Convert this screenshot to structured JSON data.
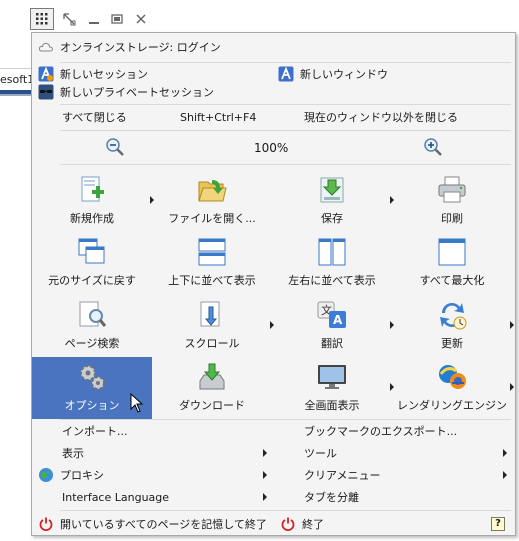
{
  "background": {
    "url_fragment": "esoft1"
  },
  "titlebar": {
    "menu_icon": "grid-menu-icon",
    "buttons": [
      "restore-down-icon",
      "minimize-icon",
      "maximize-icon",
      "close-icon"
    ]
  },
  "menu": {
    "online_storage": "オンラインストレージ: ログイン",
    "new_session": "新しいセッション",
    "new_window": "新しいウィンドウ",
    "new_private_session": "新しいプライベートセッション",
    "close_all": "すべて閉じる",
    "close_all_shortcut": "Shift+Ctrl+F4",
    "close_others": "現在のウィンドウ以外を閉じる",
    "zoom_level": "100%",
    "grid": [
      {
        "label": "新規作成",
        "icon": "new-document-icon",
        "submenu": true
      },
      {
        "label": "ファイルを開く...",
        "icon": "open-folder-icon",
        "submenu": false
      },
      {
        "label": "保存",
        "icon": "save-icon",
        "submenu": true
      },
      {
        "label": "印刷",
        "icon": "printer-icon",
        "submenu": false
      },
      {
        "label": "元のサイズに戻す",
        "icon": "cascade-windows-icon",
        "submenu": false
      },
      {
        "label": "上下に並べて表示",
        "icon": "tile-horizontal-icon",
        "submenu": false
      },
      {
        "label": "左右に並べて表示",
        "icon": "tile-vertical-icon",
        "submenu": false
      },
      {
        "label": "すべて最大化",
        "icon": "maximize-all-icon",
        "submenu": false
      },
      {
        "label": "ページ検索",
        "icon": "page-search-icon",
        "submenu": false
      },
      {
        "label": "スクロール",
        "icon": "scroll-icon",
        "submenu": true
      },
      {
        "label": "翻訳",
        "icon": "translate-icon",
        "submenu": true
      },
      {
        "label": "更新",
        "icon": "refresh-icon",
        "submenu": true
      },
      {
        "label": "オプション",
        "icon": "options-gears-icon",
        "submenu": false,
        "selected": true
      },
      {
        "label": "ダウンロード",
        "icon": "download-icon",
        "submenu": false
      },
      {
        "label": "全画面表示",
        "icon": "fullscreen-monitor-icon",
        "submenu": true
      },
      {
        "label": "レンダリングエンジン",
        "icon": "rendering-engine-icon",
        "submenu": true
      }
    ],
    "import": "インポート...",
    "export_bookmarks": "ブックマークのエクスポート...",
    "view": "表示",
    "tools": "ツール",
    "proxy": "プロキシ",
    "clear_menu": "クリアメニュー",
    "interface_language": "Interface Language",
    "split_tab": "タブを分離",
    "remember_and_exit": "開いているすべてのページを記憶して終了",
    "exit": "終了",
    "help": "?"
  },
  "colors": {
    "selected_bg": "#4a73c0",
    "menu_bg": "#f4f4f4",
    "power_red": "#d42020"
  }
}
